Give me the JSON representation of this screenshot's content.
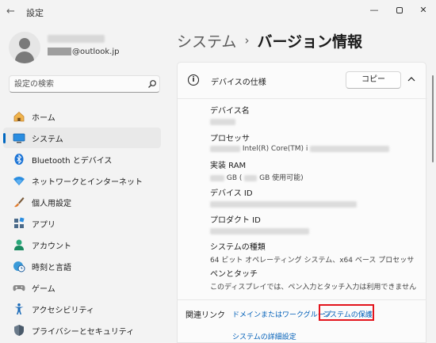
{
  "window": {
    "title": "設定",
    "back_icon": "back-arrow-icon",
    "controls": [
      "minimize",
      "maximize",
      "close"
    ]
  },
  "profile": {
    "email_suffix": "@outlook.jp",
    "avatar_icon": "person-icon"
  },
  "search": {
    "placeholder": "設定の検索",
    "icon": "search-icon"
  },
  "sidebar": {
    "items": [
      {
        "label": "ホーム",
        "icon": "home-icon",
        "active": false
      },
      {
        "label": "システム",
        "icon": "monitor-icon",
        "active": true
      },
      {
        "label": "Bluetooth とデバイス",
        "icon": "bluetooth-icon",
        "active": false
      },
      {
        "label": "ネットワークとインターネット",
        "icon": "wifi-icon",
        "active": false
      },
      {
        "label": "個人用設定",
        "icon": "brush-icon",
        "active": false
      },
      {
        "label": "アプリ",
        "icon": "apps-icon",
        "active": false
      },
      {
        "label": "アカウント",
        "icon": "account-icon",
        "active": false
      },
      {
        "label": "時刻と言語",
        "icon": "globe-clock-icon",
        "active": false
      },
      {
        "label": "ゲーム",
        "icon": "gamepad-icon",
        "active": false
      },
      {
        "label": "アクセシビリティ",
        "icon": "accessibility-icon",
        "active": false
      },
      {
        "label": "プライバシーとセキュリティ",
        "icon": "shield-icon",
        "active": false
      }
    ]
  },
  "header": {
    "parent": "システム",
    "separator": "›",
    "current": "バージョン情報"
  },
  "device_spec": {
    "title": "デバイスの仕様",
    "copy_label": "コピー",
    "device_name_label": "デバイス名",
    "processor_label": "プロセッサ",
    "processor_value": "Intel(R) Core(TM) i",
    "ram_label": "実装 RAM",
    "ram_value_gb": "GB (",
    "ram_value_usable": "GB 使用可能)",
    "device_id_label": "デバイス ID",
    "product_id_label": "プロダクト ID",
    "system_type_label": "システムの種類",
    "system_type_value": "64 ビット オペレーティング システム、x64 ベース プロセッサ",
    "pen_touch_label": "ペンとタッチ",
    "pen_touch_value": "このディスプレイでは、ペン入力とタッチ入力は利用できません"
  },
  "related": {
    "label": "関連リンク",
    "links": [
      "ドメインまたはワークグループ",
      "システムの保護",
      "システムの詳細設定"
    ]
  },
  "colors": {
    "accent": "#0067c0",
    "link": "#005fb8",
    "highlight": "#e3141c"
  }
}
